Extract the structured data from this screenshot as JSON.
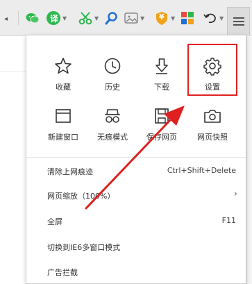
{
  "toolbar": {
    "translate_label": "译",
    "wallet_label": "¥"
  },
  "menu": {
    "tiles": [
      {
        "label": "收藏",
        "icon": "star-icon"
      },
      {
        "label": "历史",
        "icon": "clock-icon"
      },
      {
        "label": "下载",
        "icon": "download-icon"
      },
      {
        "label": "设置",
        "icon": "gear-icon"
      },
      {
        "label": "新建窗口",
        "icon": "new-window-icon"
      },
      {
        "label": "无痕模式",
        "icon": "glasses-icon"
      },
      {
        "label": "保存网页",
        "icon": "save-icon"
      },
      {
        "label": "网页快照",
        "icon": "camera-icon"
      }
    ],
    "items": [
      {
        "label": "清除上网痕迹",
        "shortcut": "Ctrl+Shift+Delete"
      },
      {
        "label": "网页缩放（100%）",
        "chevron": "›"
      },
      {
        "label": "全屏",
        "shortcut": "F11"
      },
      {
        "label": "切换到IE6多窗口模式"
      },
      {
        "label": "广告拦截"
      }
    ]
  },
  "colors": {
    "highlight": "#e02020",
    "green": "#2db84d",
    "blue": "#1f6fd6"
  }
}
